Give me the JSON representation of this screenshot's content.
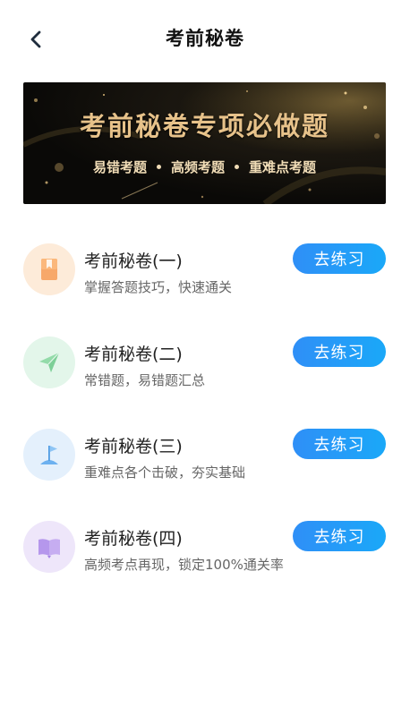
{
  "header": {
    "title": "考前秘卷"
  },
  "banner": {
    "title": "考前秘卷专项必做题",
    "tags": [
      "易错考题",
      "高频考题",
      "重难点考题"
    ]
  },
  "items": [
    {
      "title": "考前秘卷(一)",
      "desc": "掌握答题技巧，快速通关",
      "button": "去练习",
      "icon": "bookmark-icon",
      "icon_bg": "#fdebd9",
      "icon_color": "#f7a86a"
    },
    {
      "title": "考前秘卷(二)",
      "desc": "常错题，易错题汇总",
      "button": "去练习",
      "icon": "paper-plane-icon",
      "icon_bg": "#e3f6ea",
      "icon_color": "#93dba9"
    },
    {
      "title": "考前秘卷(三)",
      "desc": "重难点各个击破，夯实基础",
      "button": "去练习",
      "icon": "flag-icon",
      "icon_bg": "#e4f0fc",
      "icon_color": "#6db1f0"
    },
    {
      "title": "考前秘卷(四)",
      "desc": "高频考点再现，锁定100%通关率",
      "button": "去练习",
      "icon": "open-book-icon",
      "icon_bg": "#eee6fa",
      "icon_color": "#b597ec"
    }
  ]
}
